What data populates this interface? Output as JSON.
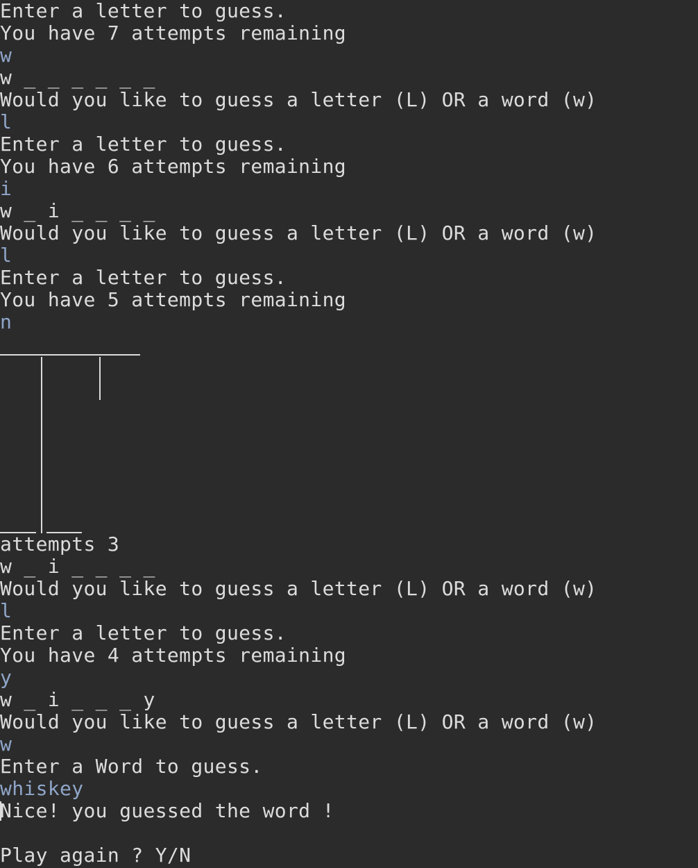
{
  "console": {
    "lines_before_gallows": [
      {
        "text": "Enter a letter to guess.",
        "type": "output"
      },
      {
        "text": "You have 7 attempts remaining",
        "type": "output"
      },
      {
        "text": "w",
        "type": "input"
      },
      {
        "text": "w _ _ _ _ _ _",
        "type": "output"
      },
      {
        "text": "Would you like to guess a letter (L) OR a word (w)",
        "type": "output"
      },
      {
        "text": "l",
        "type": "input"
      },
      {
        "text": "Enter a letter to guess.",
        "type": "output"
      },
      {
        "text": "You have 6 attempts remaining",
        "type": "output"
      },
      {
        "text": "i",
        "type": "input"
      },
      {
        "text": "w _ i _ _ _ _",
        "type": "output"
      },
      {
        "text": "Would you like to guess a letter (L) OR a word (w)",
        "type": "output"
      },
      {
        "text": "l",
        "type": "input"
      },
      {
        "text": "Enter a letter to guess.",
        "type": "output"
      },
      {
        "text": "You have 5 attempts remaining",
        "type": "output"
      },
      {
        "text": "n",
        "type": "input"
      }
    ],
    "lines_after_gallows": [
      {
        "text": "attempts 3",
        "type": "output"
      },
      {
        "text": "w _ i _ _ _ _",
        "type": "output"
      },
      {
        "text": "Would you like to guess a letter (L) OR a word (w)",
        "type": "output"
      },
      {
        "text": "l",
        "type": "input"
      },
      {
        "text": "Enter a letter to guess.",
        "type": "output"
      },
      {
        "text": "You have 4 attempts remaining",
        "type": "output"
      },
      {
        "text": "y",
        "type": "input"
      },
      {
        "text": "w _ i _ _ _ y",
        "type": "output"
      },
      {
        "text": "Would you like to guess a letter (L) OR a word (w)",
        "type": "output"
      },
      {
        "text": "w",
        "type": "input"
      },
      {
        "text": "Enter a Word to guess.",
        "type": "output"
      },
      {
        "text": "whiskey",
        "type": "input"
      }
    ],
    "result_line": "Nice! you guessed the word !",
    "blank_line": "",
    "prompt_line": "Play again ? Y/N"
  },
  "colors": {
    "background": "#2b2b2b",
    "output_text": "#dcdcdc",
    "input_text": "#8fa6c9"
  }
}
